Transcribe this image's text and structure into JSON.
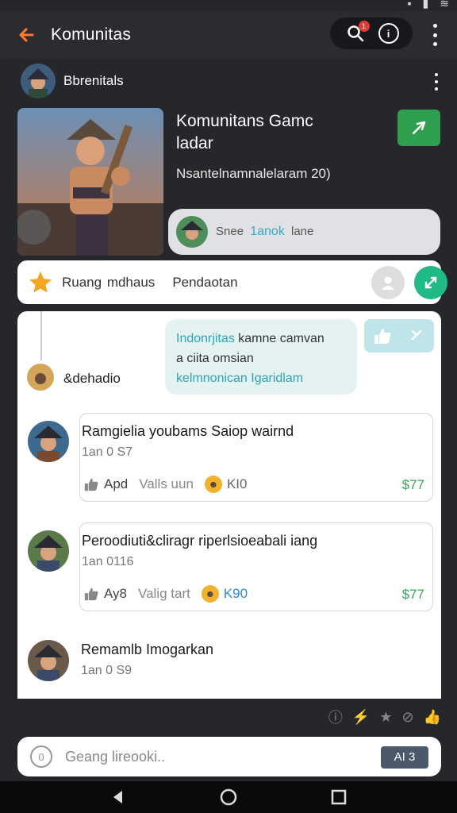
{
  "app_bar": {
    "title": "Komunitas",
    "notification_count": "1"
  },
  "profile": {
    "name": "Bbrenitals"
  },
  "hero": {
    "title": "Komunitans Gamc ladar",
    "subtitle": "Nsantelnamnalelaram 20)",
    "member_prefix": "Snee",
    "member_highlight": "1anok",
    "member_suffix": "lane"
  },
  "category": {
    "label": "Ruang mdhaus",
    "label2": "Pendaotan"
  },
  "thread": {
    "name": "&dehadio",
    "bubble_teal": "Indonrjitas",
    "bubble_text1": "kamne camvan",
    "bubble_text2": "a ciita omsian",
    "bubble_teal2": "kelmnonican Igaridlam"
  },
  "posts": [
    {
      "title": "Ramgielia youbams Saiop wairnd",
      "meta": "1an 0 S7",
      "likes": "Apd",
      "reply": "Valls uun",
      "tag": "KI0",
      "tag_blue": false,
      "count": "$77"
    },
    {
      "title": "Peroodiuti&cliragr riperlsioeabali iang",
      "meta": "1an 0116",
      "likes": "Ay8",
      "reply": "Valig tart",
      "tag": "K90",
      "tag_blue": true,
      "count": "$77"
    },
    {
      "title": "Remamlb Imogarkan",
      "meta": "1an 0 S9"
    }
  ],
  "input": {
    "placeholder": "Geang lireooki..",
    "ai_label": "AI 3"
  },
  "colors": {
    "accent_green": "#2e9e4f",
    "teal": "#1fba86",
    "background": "#26272b"
  }
}
